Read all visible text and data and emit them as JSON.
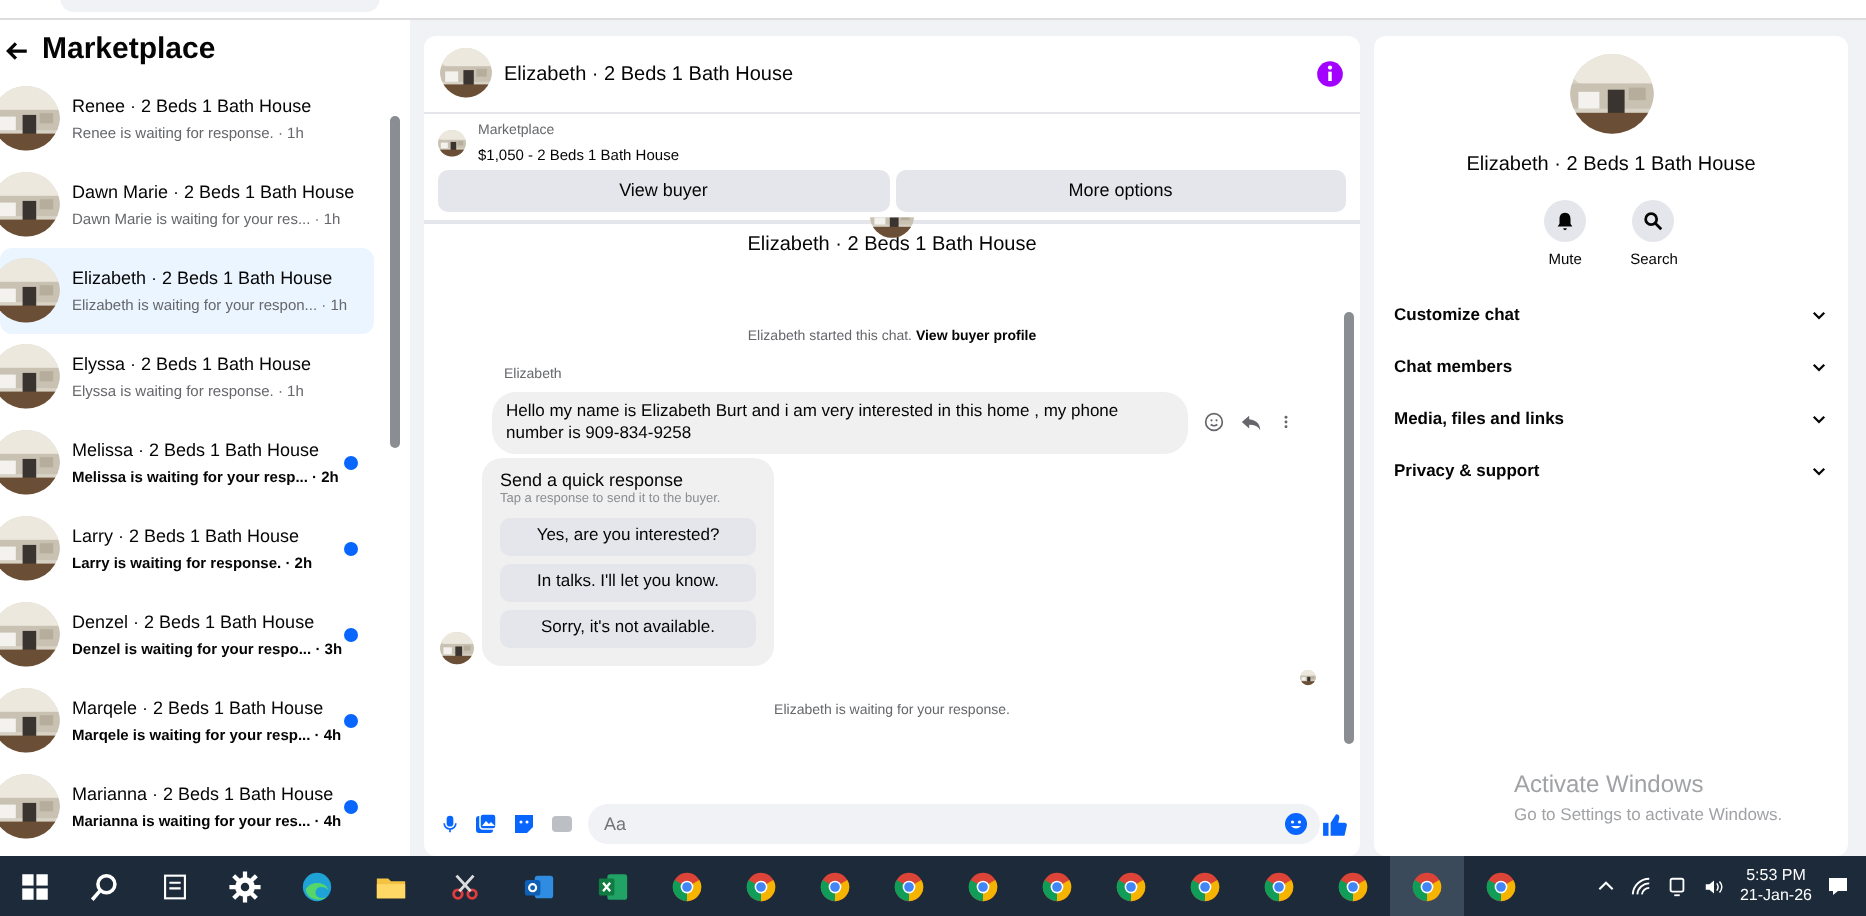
{
  "sidebar": {
    "title": "Marketplace",
    "conversations": [
      {
        "name": "Renee · 2 Beds 1 Bath House",
        "preview": "Renee is waiting for response.",
        "time": "· 1h",
        "unread": false,
        "selected": false
      },
      {
        "name": "Dawn Marie · 2 Beds 1 Bath House",
        "preview": "Dawn Marie is waiting for your res...",
        "time": "· 1h",
        "unread": false,
        "selected": false
      },
      {
        "name": "Elizabeth · 2 Beds 1 Bath House",
        "preview": "Elizabeth is waiting for your respon...",
        "time": "· 1h",
        "unread": false,
        "selected": true
      },
      {
        "name": "Elyssa · 2 Beds 1 Bath House",
        "preview": "Elyssa is waiting for response.",
        "time": "· 1h",
        "unread": false,
        "selected": false
      },
      {
        "name": "Melissa · 2 Beds 1 Bath House",
        "preview": "Melissa is waiting for your resp...",
        "time": "· 2h",
        "unread": true,
        "selected": false
      },
      {
        "name": "Larry · 2 Beds 1 Bath House",
        "preview": "Larry is waiting for response.",
        "time": "· 2h",
        "unread": true,
        "selected": false
      },
      {
        "name": "Denzel · 2 Beds 1 Bath House",
        "preview": "Denzel is waiting for your respo...",
        "time": "· 3h",
        "unread": true,
        "selected": false
      },
      {
        "name": "Marqele · 2 Beds 1 Bath House",
        "preview": "Marqele is waiting for your resp...",
        "time": "· 4h",
        "unread": true,
        "selected": false
      },
      {
        "name": "Marianna · 2 Beds 1 Bath House",
        "preview": "Marianna is waiting for your res...",
        "time": "· 4h",
        "unread": true,
        "selected": false
      }
    ]
  },
  "chat": {
    "title": "Elizabeth · 2 Beds 1 Bath House",
    "listing": {
      "label": "Marketplace",
      "price_title": "$1,050 - 2 Beds 1 Bath House"
    },
    "buttons": [
      "View buyer",
      "More options"
    ],
    "thread_title": "Elizabeth · 2 Beds 1 Bath House",
    "started_note": "Elizabeth started this chat.",
    "started_link": "View buyer profile",
    "sender": "Elizabeth",
    "message": "Hello my name is Elizabeth Burt and i am very interested in this home , my phone number is 909-834-9258",
    "quick": {
      "title": "Send a quick response",
      "hint": "Tap a response to send it to the buyer.",
      "options": [
        "Yes, are you interested?",
        "In talks. I'll let you know.",
        "Sorry, it's not available."
      ]
    },
    "waiting_note": "Elizabeth is waiting for your response.",
    "composer": {
      "placeholder": "Aa"
    }
  },
  "details": {
    "title": "Elizabeth · 2 Beds 1 Bath House",
    "actions": [
      "Mute",
      "Search"
    ],
    "sections": [
      "Customize chat",
      "Chat members",
      "Media, files and links",
      "Privacy & support"
    ]
  },
  "watermark": {
    "title": "Activate Windows",
    "subtitle": "Go to Settings to activate Windows."
  },
  "taskbar": {
    "apps": [
      {
        "kind": "start",
        "selected": false
      },
      {
        "kind": "search",
        "selected": false
      },
      {
        "kind": "taskview",
        "selected": false
      },
      {
        "kind": "settings",
        "selected": false
      },
      {
        "kind": "edge",
        "selected": false
      },
      {
        "kind": "folder",
        "selected": false
      },
      {
        "kind": "snip",
        "selected": false
      },
      {
        "kind": "outlook",
        "selected": false
      },
      {
        "kind": "excel",
        "selected": false
      },
      {
        "kind": "chrome",
        "selected": false
      },
      {
        "kind": "chrome",
        "selected": false
      },
      {
        "kind": "chrome",
        "selected": false
      },
      {
        "kind": "chrome",
        "selected": false
      },
      {
        "kind": "chrome",
        "selected": false
      },
      {
        "kind": "chrome",
        "selected": false
      },
      {
        "kind": "chrome",
        "selected": false
      },
      {
        "kind": "chrome",
        "selected": false
      },
      {
        "kind": "chrome",
        "selected": false
      },
      {
        "kind": "chrome",
        "selected": false
      },
      {
        "kind": "chrome",
        "selected": true
      },
      {
        "kind": "chrome",
        "selected": false
      }
    ],
    "time": "5:53 PM",
    "date": "21-Jan-26"
  }
}
